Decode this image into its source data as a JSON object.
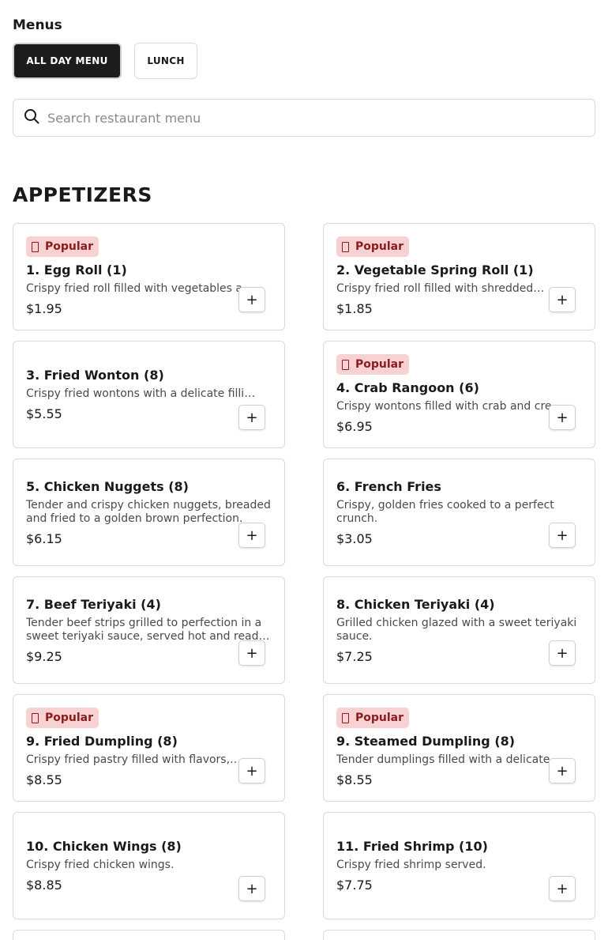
{
  "menus": {
    "title": "Menus",
    "tabs": [
      {
        "label": "ALL DAY MENU",
        "active": true
      },
      {
        "label": "LUNCH",
        "active": false
      }
    ]
  },
  "search": {
    "icon": "search-icon",
    "placeholder": "Search restaurant menu"
  },
  "section": {
    "title": "APPETIZERS"
  },
  "badge_label": "Popular",
  "add_label": "+",
  "colors": {
    "accent_dark": "#1c1c1c",
    "badge_bg": "#f8d2d2",
    "badge_text": "#8a1c1c"
  },
  "items": [
    {
      "name": "1. Egg Roll (1)",
      "description": "Crispy fried roll filled with vegetables and…",
      "price": "$1.95",
      "popular": true
    },
    {
      "name": "2. Vegetable Spring Roll (1)",
      "description": "Crispy fried roll filled with shredded…",
      "price": "$1.85",
      "popular": true
    },
    {
      "name": "3. Fried Wonton (8)",
      "description": "Crispy fried wontons with a delicate filling.",
      "price": "$5.55",
      "popular": false
    },
    {
      "name": "4. Crab Rangoon (6)",
      "description": "Crispy wontons filled with crab and cream…",
      "price": "$6.95",
      "popular": true
    },
    {
      "name": "5. Chicken Nuggets (8)",
      "description": "Tender and crispy chicken nuggets, breaded and fried to a golden brown perfection.",
      "price": "$6.15",
      "popular": false
    },
    {
      "name": "6. French Fries",
      "description": "Crispy, golden fries cooked to a perfect crunch.",
      "price": "$3.05",
      "popular": false
    },
    {
      "name": "7. Beef Teriyaki (4)",
      "description": "Tender beef strips grilled to perfection in a sweet teriyaki sauce, served hot and ready to enjoy.",
      "price": "$9.25",
      "popular": false
    },
    {
      "name": "8. Chicken Teriyaki (4)",
      "description": "Grilled chicken glazed with a sweet teriyaki sauce.",
      "price": "$7.25",
      "popular": false
    },
    {
      "name": "9. Fried Dumpling (8)",
      "description": "Crispy fried pastry filled with flavors,…",
      "price": "$8.55",
      "popular": true
    },
    {
      "name": "9. Steamed Dumpling (8)",
      "description": "Tender dumplings filled with a delicate…",
      "price": "$8.55",
      "popular": true
    },
    {
      "name": "10. Chicken Wings (8)",
      "description": "Crispy fried chicken wings.",
      "price": "$8.85",
      "popular": false
    },
    {
      "name": "11. Fried Shrimp (10)",
      "description": "Crispy fried shrimp served.",
      "price": "$7.75",
      "popular": false
    }
  ]
}
